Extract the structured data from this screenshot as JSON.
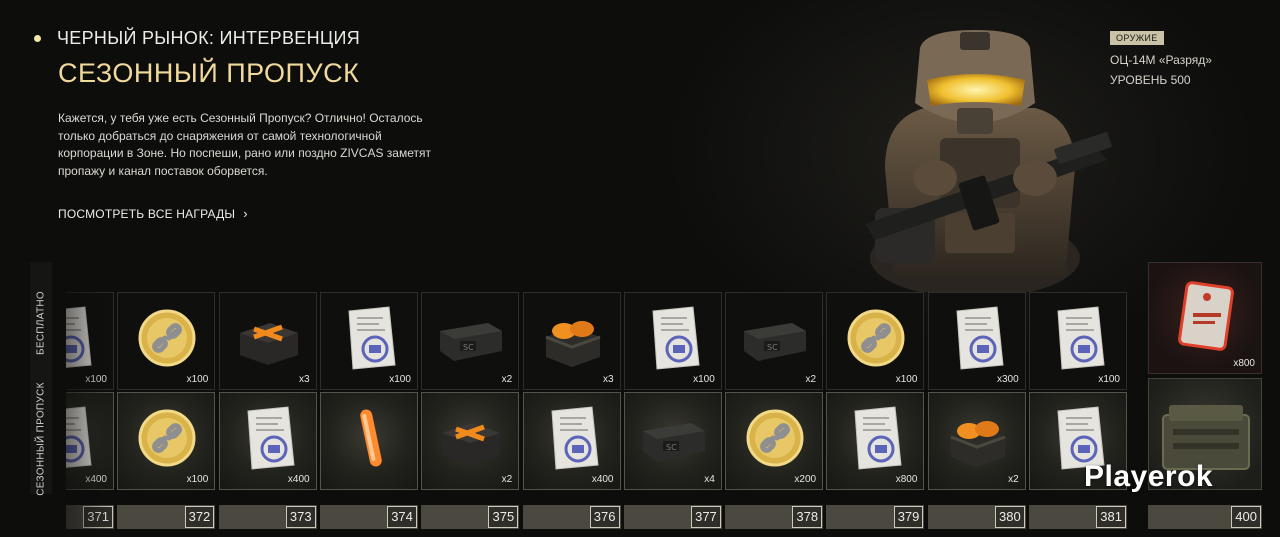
{
  "header": {
    "season_title": "ЧЕРНЫЙ РЫНОК: ИНТЕРВЕНЦИЯ",
    "page_title": "СЕЗОННЫЙ ПРОПУСК",
    "description": "Кажется, у тебя уже есть Сезонный Пропуск? Отлично! Осталось только добраться до снаряжения от самой технологичной корпорации в Зоне. Но поспеши, рано или поздно ZIVCAS заметят пропажу и канал поставок оборвется.",
    "all_rewards_link": "ПОСМОТРЕТЬ ВСЕ НАГРАДЫ"
  },
  "weapon": {
    "badge": "ОРУЖИЕ",
    "name": "ОЦ-14М «Разряд»",
    "level": "УРОВЕНЬ 500"
  },
  "tracks": {
    "free_label": "БЕСПЛАТНО",
    "pass_label": "СЕЗОННЫЙ ПРОПУСК"
  },
  "free_rewards": [
    {
      "icon": "paper-icon",
      "qty": "x100"
    },
    {
      "icon": "coin-icon",
      "qty": "x100"
    },
    {
      "icon": "orange-box-icon",
      "qty": "x3"
    },
    {
      "icon": "paper-icon",
      "qty": "x100"
    },
    {
      "icon": "crate-icon",
      "qty": "x2"
    },
    {
      "icon": "orange-open-box-icon",
      "qty": "x3"
    },
    {
      "icon": "paper-icon",
      "qty": "x100"
    },
    {
      "icon": "crate-icon",
      "qty": "x2"
    },
    {
      "icon": "coin-icon",
      "qty": "x100"
    },
    {
      "icon": "paper-icon",
      "qty": "x300"
    },
    {
      "icon": "paper-icon",
      "qty": "x100"
    }
  ],
  "pass_rewards": [
    {
      "icon": "paper-icon",
      "qty": "x400"
    },
    {
      "icon": "coin-icon",
      "qty": "x100"
    },
    {
      "icon": "paper-icon",
      "qty": "x400"
    },
    {
      "icon": "glowstick-icon",
      "qty": ""
    },
    {
      "icon": "orange-box-icon",
      "qty": "x2"
    },
    {
      "icon": "paper-icon",
      "qty": "x400"
    },
    {
      "icon": "crate-icon",
      "qty": "x4"
    },
    {
      "icon": "coin-icon",
      "qty": "x200"
    },
    {
      "icon": "paper-icon",
      "qty": "x800"
    },
    {
      "icon": "orange-open-box-icon",
      "qty": "x2"
    },
    {
      "icon": "paper-icon",
      "qty": ""
    }
  ],
  "levels": [
    "371",
    "372",
    "373",
    "374",
    "375",
    "376",
    "377",
    "378",
    "379",
    "380",
    "381"
  ],
  "special": {
    "free_icon": "red-tag-icon",
    "free_qty": "x800",
    "pass_icon": "military-chest-icon",
    "level": "400"
  },
  "watermark": "Playerok"
}
